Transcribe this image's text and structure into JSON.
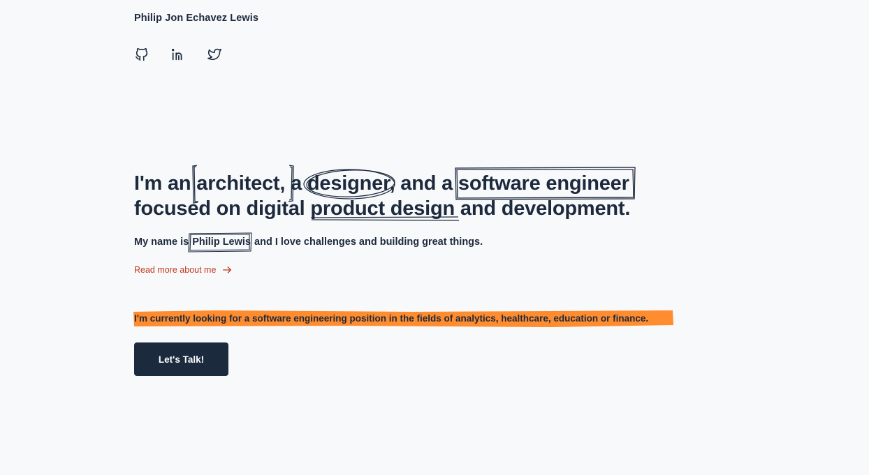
{
  "header": {
    "site_name": "Philip Jon Echavez Lewis",
    "social": [
      {
        "icon": "github-icon"
      },
      {
        "icon": "linkedin-icon"
      },
      {
        "icon": "twitter-icon"
      }
    ]
  },
  "hero": {
    "line1_pre": "I'm an ",
    "architect": "architect,",
    "a1": " a ",
    "designer": "designer,",
    "and_a": " and a ",
    "software_engineer": "software engineer",
    "line2_pre": "focused on digital ",
    "product_design": "product design",
    "line2_post": " and development."
  },
  "intro": {
    "pre": "My name is ",
    "name": "Philip Lewis",
    "post": " and I love challenges and building great things."
  },
  "read_more": {
    "label": "Read more about me",
    "icon": "arrow-right-icon"
  },
  "availability": {
    "text": "I'm currently looking for a software engineering position in the fields of analytics, healthcare, education or finance."
  },
  "cta": {
    "label": "Let's Talk!"
  },
  "colors": {
    "text": "#1d2a3d",
    "background": "#f8f9fb",
    "accent_link": "#c0391b",
    "highlight": "#ff8c2e",
    "button": "#1c2a3d"
  }
}
